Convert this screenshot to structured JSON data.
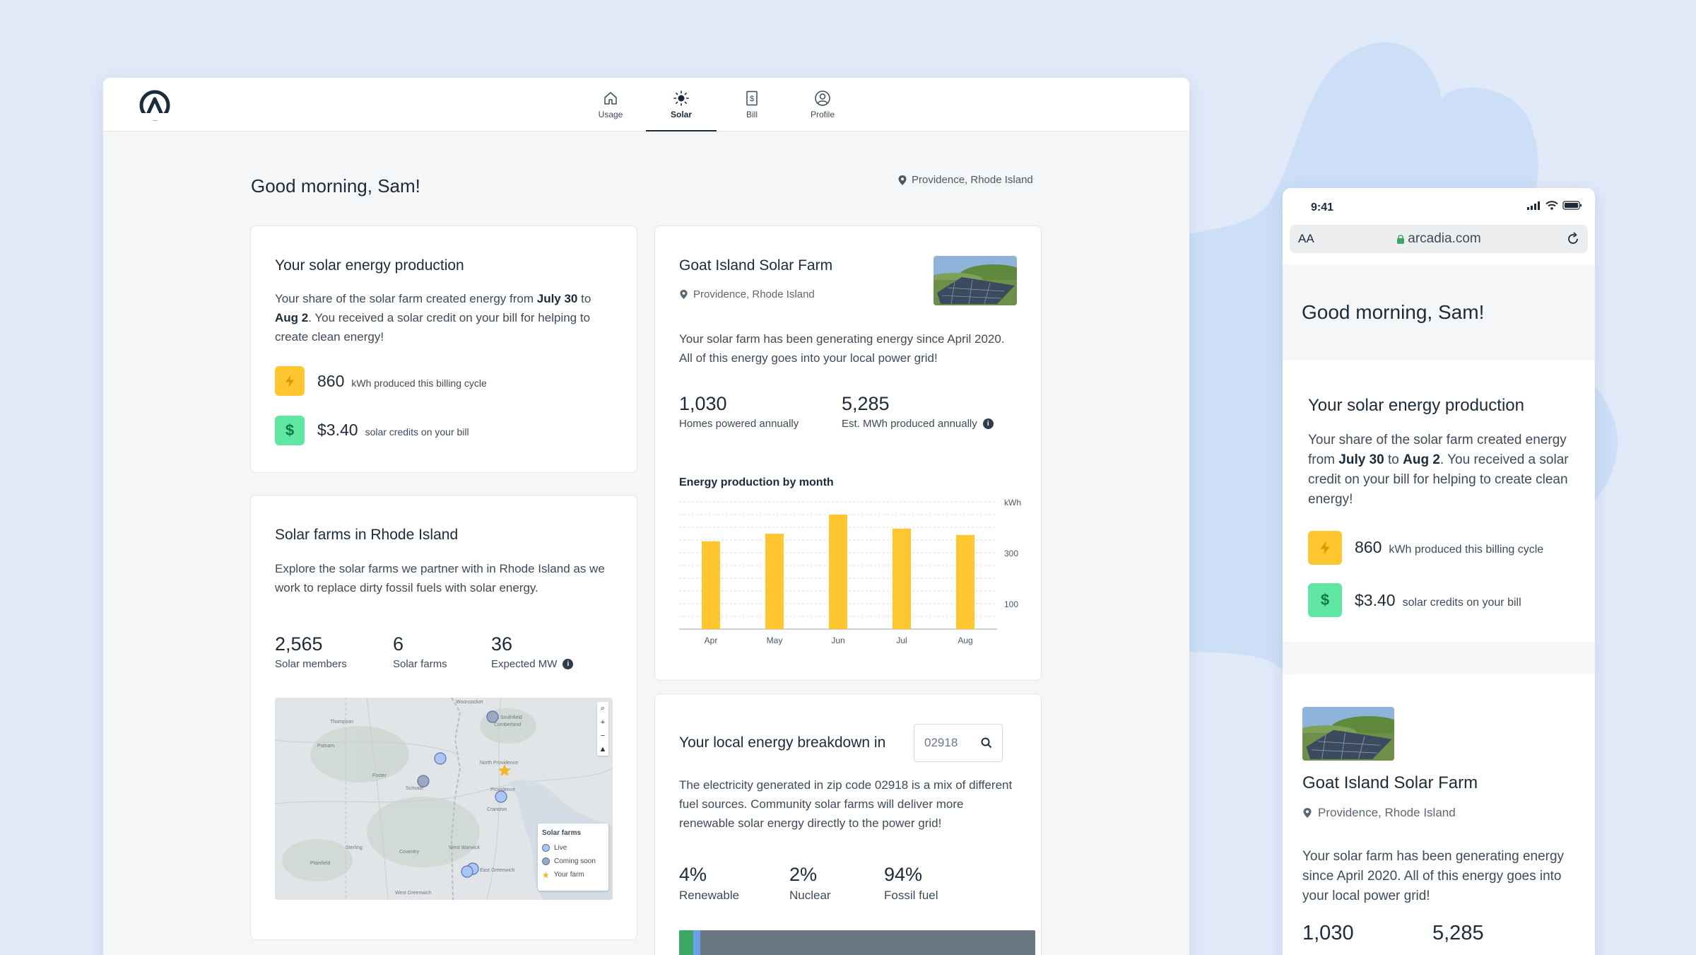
{
  "nav": {
    "tabs": [
      {
        "label": "Usage",
        "icon": "home-icon"
      },
      {
        "label": "Solar",
        "icon": "sun-icon"
      },
      {
        "label": "Bill",
        "icon": "bill-icon"
      },
      {
        "label": "Profile",
        "icon": "profile-icon"
      }
    ],
    "active": "Solar"
  },
  "greeting": "Good morning, Sam!",
  "location": "Providence, Rhode Island",
  "production": {
    "title": "Your solar energy production",
    "intro_1": "Your share of the solar farm created energy from ",
    "start_date": "July 30",
    "intro_to": " to",
    "end_date": "Aug 2",
    "intro_2": ". You received a solar credit on your bill for helping to create clean energy!",
    "kwh_value": "860",
    "kwh_label": "kWh produced this billing cycle",
    "credit_value": "$3.40",
    "credit_label": "solar credits on your bill"
  },
  "farms_ri": {
    "title": "Solar farms in Rhode Island",
    "body": "Explore the solar farms we partner with in Rhode Island as we work to replace dirty fossil fuels with solar energy.",
    "stats": [
      {
        "value": "2,565",
        "label": "Solar members"
      },
      {
        "value": "6",
        "label": "Solar farms"
      },
      {
        "value": "36",
        "label": "Expected MW"
      }
    ],
    "map": {
      "legend_title": "Solar farms",
      "legend": [
        "Live",
        "Coming soon",
        "Your farm"
      ],
      "places": [
        "Woonsocket",
        "North Smithfield",
        "Cumberland",
        "Putnam",
        "Thompson",
        "Foster",
        "Scituate",
        "North Providence",
        "Providence",
        "Cranston",
        "Sterling",
        "Coventry",
        "West Warwick",
        "Plainfield",
        "East Greenwich",
        "West Greenwich"
      ]
    }
  },
  "farm": {
    "name": "Goat Island Solar Farm",
    "location": "Providence, Rhode Island",
    "body": "Your solar farm has been generating energy since April 2020. All of this energy goes into your local power grid!",
    "homes_value": "1,030",
    "homes_label": "Homes powered annually",
    "mwh_value": "5,285",
    "mwh_label": "Est. MWh produced annually",
    "chart_title": "Energy production by month"
  },
  "chart_data": {
    "type": "bar",
    "title": "Energy production by month",
    "categories": [
      "Apr",
      "May",
      "Jun",
      "Jul",
      "Aug"
    ],
    "values": [
      345,
      375,
      450,
      395,
      370
    ],
    "ylabel": "kWh",
    "yticks": [
      100,
      300
    ],
    "ylim": [
      0,
      500
    ],
    "grid": true,
    "colors": {
      "bar": "#ffc630"
    }
  },
  "breakdown": {
    "title": "Your local energy breakdown in",
    "zip": "02918",
    "body": "The electricity generated in zip code 02918 is a mix of different fuel sources. Community solar farms will deliver more renewable solar energy directly to the power grid!",
    "mix": [
      {
        "value": "4%",
        "label": "Renewable",
        "share": 0.04,
        "color": "#3aa864"
      },
      {
        "value": "2%",
        "label": "Nuclear",
        "share": 0.02,
        "color": "#6aa0e8"
      },
      {
        "value": "94%",
        "label": "Fossil fuel",
        "share": 0.94,
        "color": "#6b7782"
      }
    ]
  },
  "mobile": {
    "time": "9:41",
    "text_size": "AA",
    "url": "arcadia.com"
  },
  "colors": {
    "accent": "#1c2b3a",
    "yellow": "#ffc630",
    "green": "#5ee6a2",
    "bg": "#dfe9f8"
  }
}
